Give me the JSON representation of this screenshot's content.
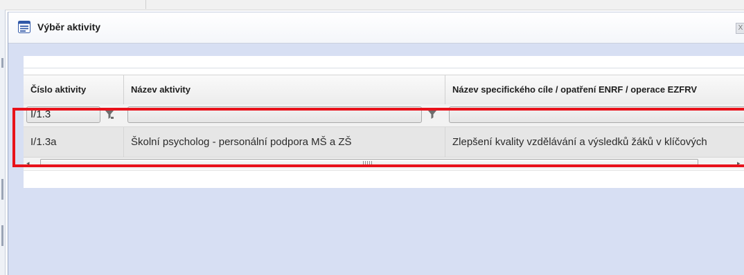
{
  "dialog": {
    "title": "Výběr aktivity",
    "close_label": "X"
  },
  "grid": {
    "columns": [
      {
        "label": "Číslo aktivity"
      },
      {
        "label": "Název aktivity"
      },
      {
        "label": "Název specifického cíle / opatření ENRF / operace EZFRV"
      }
    ],
    "filters": {
      "cislo": "I/1.3",
      "nazev": "",
      "cil": ""
    },
    "rows": [
      {
        "cislo": "I/1.3a",
        "nazev": "Školní psycholog - personální podpora MŠ a ZŠ",
        "cil": "Zlepšení kvality vzdělávání a výsledků žáků v klíčových"
      }
    ],
    "scrollbar_grip": "|||"
  },
  "colors": {
    "highlight": "#e8121b",
    "dialog_bg": "#d7dff3",
    "icon_blue": "#2f57a8"
  },
  "icons": {
    "title": "list-window-icon",
    "filter": "funnel-icon",
    "close": "close-icon"
  }
}
